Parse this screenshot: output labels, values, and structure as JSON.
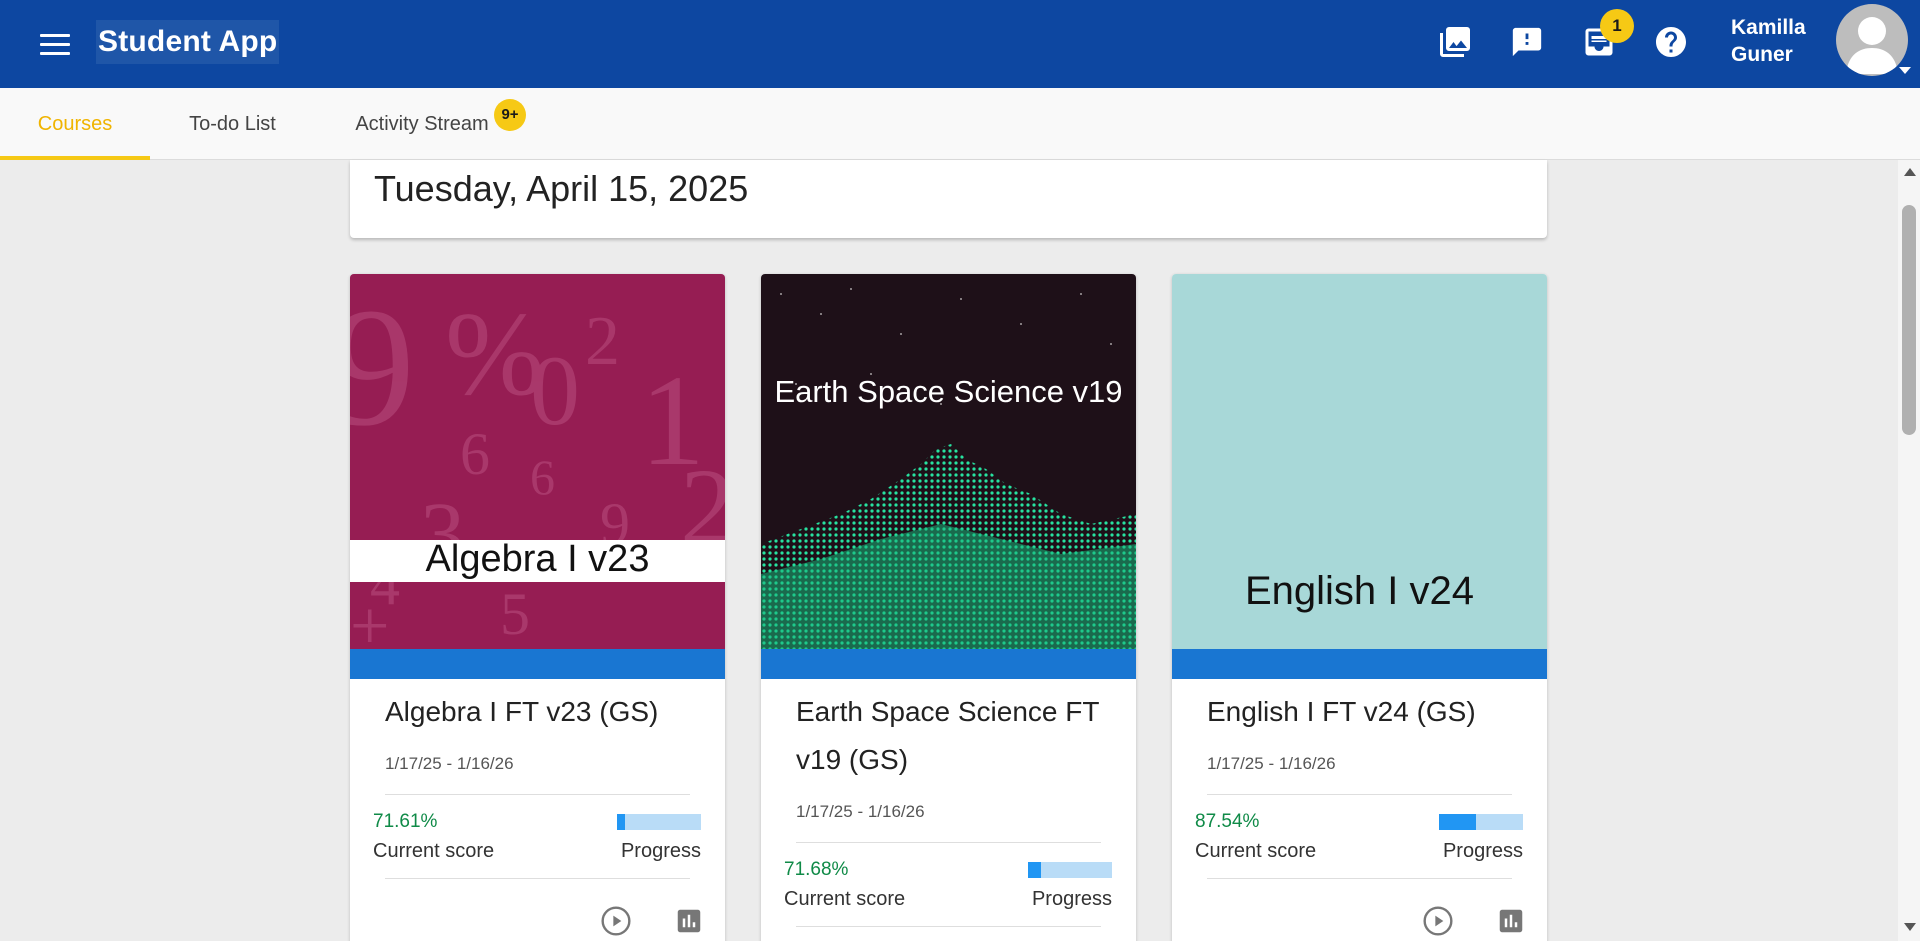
{
  "header": {
    "app_title": "Student App",
    "notification_count": "1",
    "user_first_name": "Kamilla",
    "user_last_name": "Guner",
    "icons": [
      "menu-icon",
      "gallery-icon",
      "alert-feedback-icon",
      "inbox-icon",
      "help-icon",
      "avatar-icon"
    ],
    "colors": {
      "primary": "#0d47a1",
      "accent": "#f6c915"
    }
  },
  "tabs": {
    "courses": "Courses",
    "todo": "To-do List",
    "activity": "Activity Stream",
    "activity_badge": "9+"
  },
  "date": "Tuesday, April 15, 2025",
  "courses": [
    {
      "cover_text": "Algebra I v23",
      "title": "Algebra I FT v23 (GS)",
      "dates": "1/17/25 - 1/16/26",
      "score": "71.61%",
      "score_label": "Current score",
      "progress_label": "Progress",
      "progress_fraction": 0.1
    },
    {
      "cover_text": "Earth Space Science v19",
      "title": "Earth Space Science FT v19 (GS)",
      "dates": "1/17/25 - 1/16/26",
      "score": "71.68%",
      "score_label": "Current score",
      "progress_label": "Progress",
      "progress_fraction": 0.16
    },
    {
      "cover_text": "English I v24",
      "title": "English I FT v24 (GS)",
      "dates": "1/17/25 - 1/16/26",
      "score": "87.54%",
      "score_label": "Current score",
      "progress_label": "Progress",
      "progress_fraction": 0.44
    }
  ]
}
